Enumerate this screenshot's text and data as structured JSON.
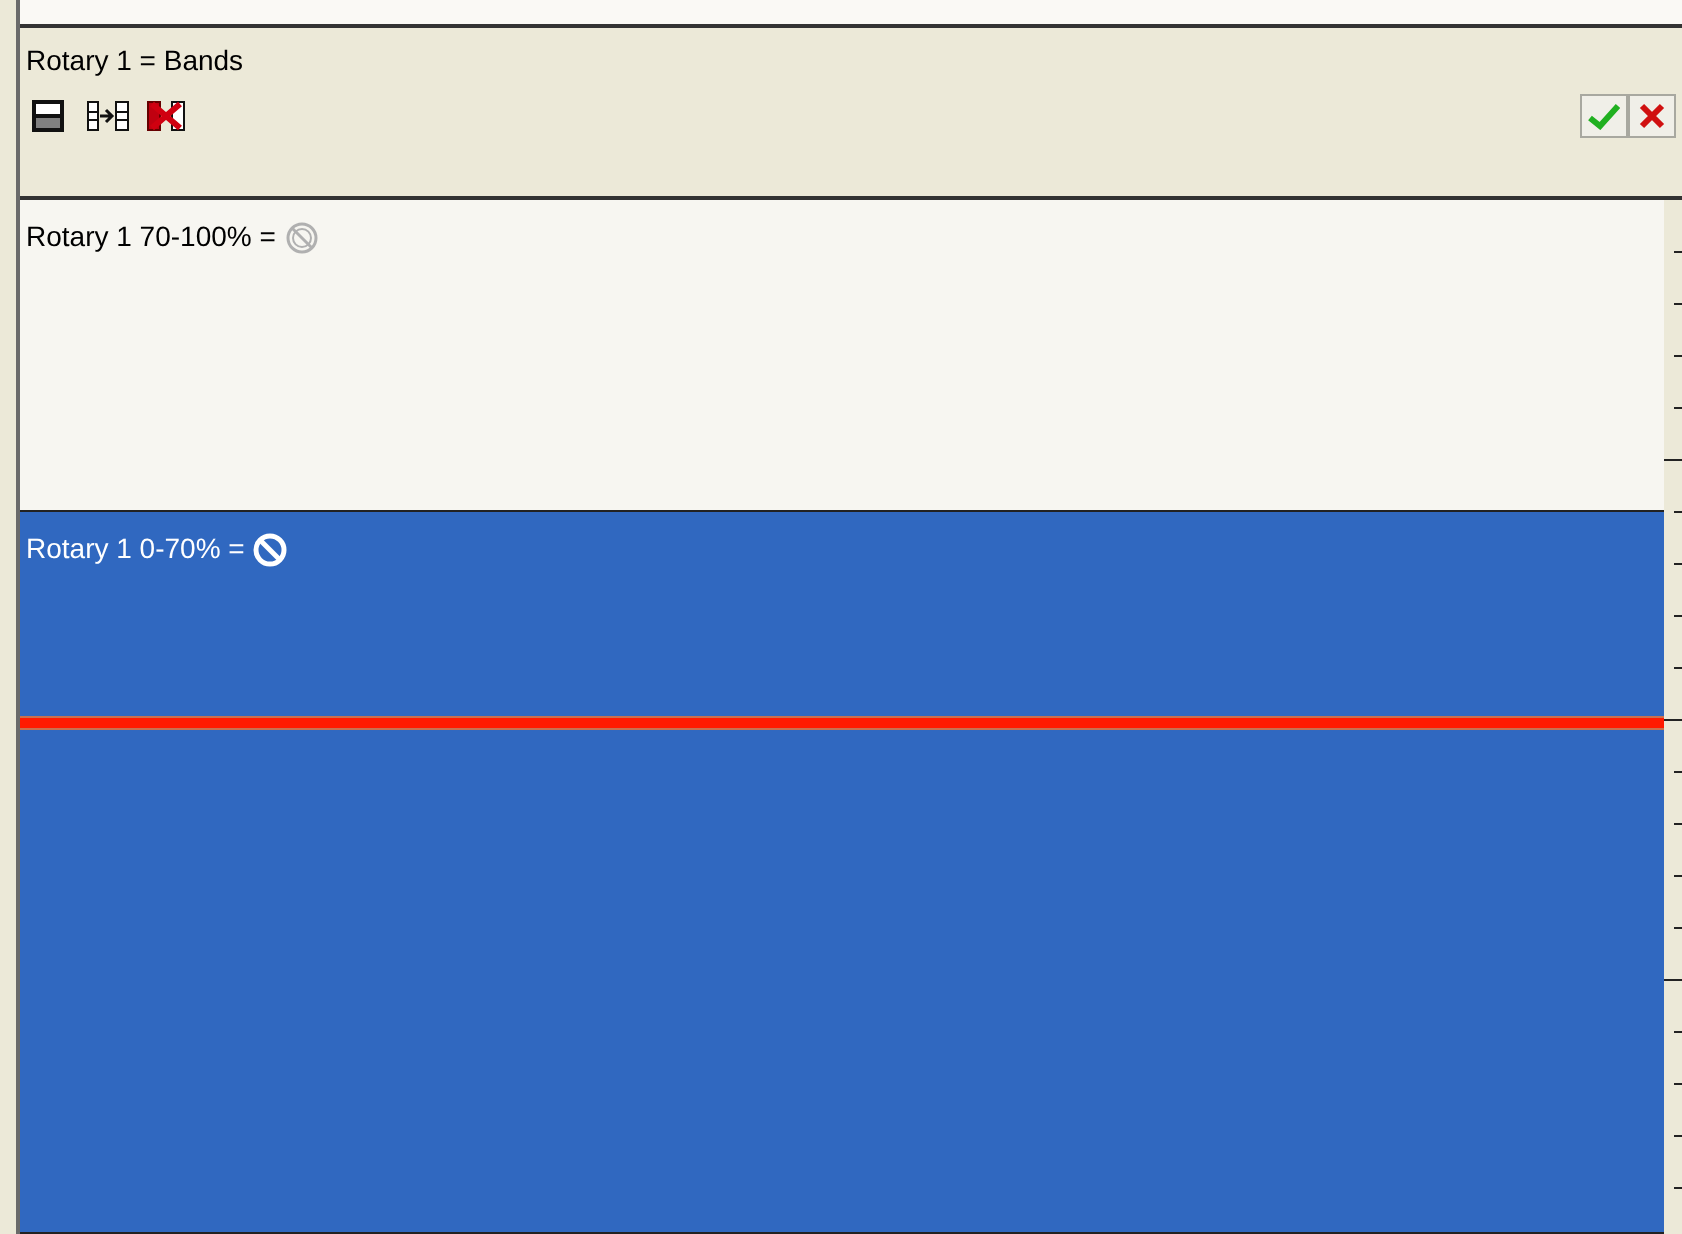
{
  "header": {
    "title": "Rotary 1 = Bands"
  },
  "bands": [
    {
      "label": "Rotary 1 70-100% =",
      "selected": false
    },
    {
      "label": "Rotary 1 0-70% =",
      "selected": true
    }
  ]
}
